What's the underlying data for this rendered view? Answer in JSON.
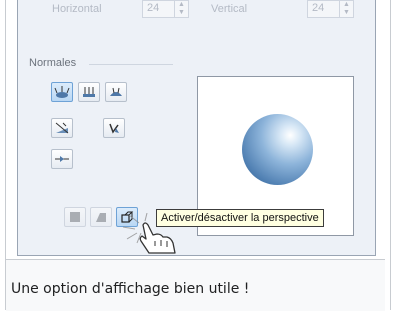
{
  "panel": {
    "horizontal_label": "Horizontal",
    "horizontal_value": "24",
    "vertical_label": "Vertical",
    "vertical_value": "24",
    "group_label": "Normales"
  },
  "tooltip": {
    "text": "Activer/désactiver la perspective"
  },
  "caption": {
    "text": "Une option d'affichage bien utile !"
  },
  "icons": {
    "normal_buttons": [
      "normals-outward-icon",
      "normals-up-icon",
      "normals-inward-icon",
      "normals-flip-icon",
      "normals-rotate-icon",
      "normals-center-icon"
    ],
    "bottom_buttons": [
      "disabled-cube-icon",
      "disabled-cube-2-icon",
      "perspective-toggle-icon"
    ],
    "cursor": "hand-pointer-icon"
  },
  "colors": {
    "active_button": "#b9d7f4",
    "sphere": "#6f9ccb",
    "tooltip_bg": "#ffffe1"
  }
}
